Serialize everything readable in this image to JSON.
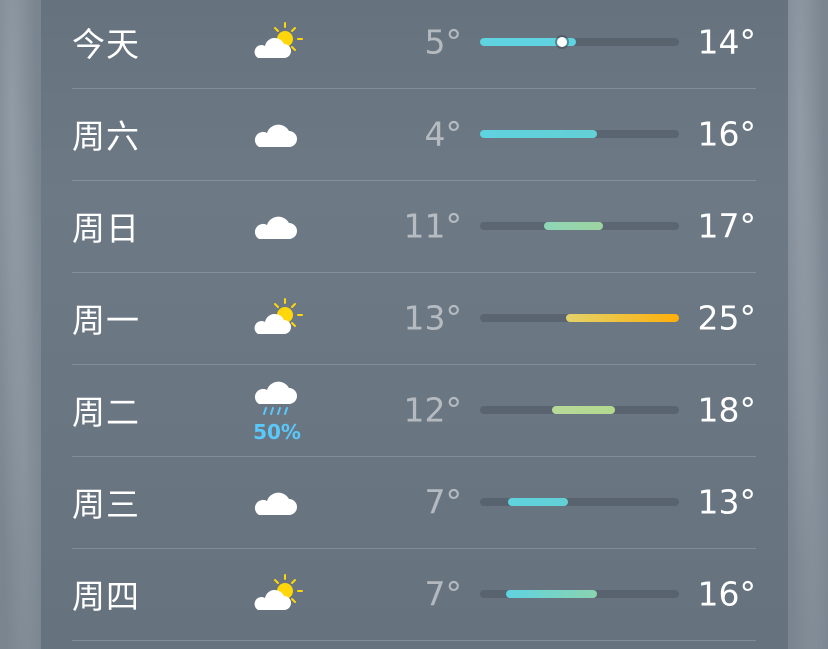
{
  "forecast": {
    "days": [
      {
        "day": "今天",
        "icon": "partly-sunny-icon",
        "low": "5°",
        "high": "14°",
        "range": [
          0.0,
          0.48
        ],
        "current": 0.41,
        "colors": [
          "#5fd3e0",
          "#5fd3e0"
        ]
      },
      {
        "day": "周六",
        "icon": "cloud-icon",
        "low": "4°",
        "high": "16°",
        "range": [
          0.0,
          0.59
        ],
        "colors": [
          "#5fd3e0",
          "#63d0d4"
        ]
      },
      {
        "day": "周日",
        "icon": "cloud-icon",
        "low": "11°",
        "high": "17°",
        "range": [
          0.32,
          0.62
        ],
        "colors": [
          "#8ed6b8",
          "#9dd3a0"
        ]
      },
      {
        "day": "周一",
        "icon": "partly-sunny-icon",
        "low": "13°",
        "high": "25°",
        "range": [
          0.43,
          1.0
        ],
        "colors": [
          "#e3d36a",
          "#ffaf0a"
        ]
      },
      {
        "day": "周二",
        "icon": "rain-cloud-icon",
        "low": "12°",
        "high": "18°",
        "range": [
          0.36,
          0.68
        ],
        "precip": "50%",
        "colors": [
          "#b7d99a",
          "#b3d98e"
        ]
      },
      {
        "day": "周三",
        "icon": "cloud-icon",
        "low": "7°",
        "high": "13°",
        "range": [
          0.14,
          0.44
        ],
        "colors": [
          "#5fd3e0",
          "#63d0d4"
        ]
      },
      {
        "day": "周四",
        "icon": "partly-sunny-icon",
        "low": "7°",
        "high": "16°",
        "range": [
          0.13,
          0.59
        ],
        "colors": [
          "#5fd3e0",
          "#8ad3b0"
        ]
      }
    ]
  }
}
